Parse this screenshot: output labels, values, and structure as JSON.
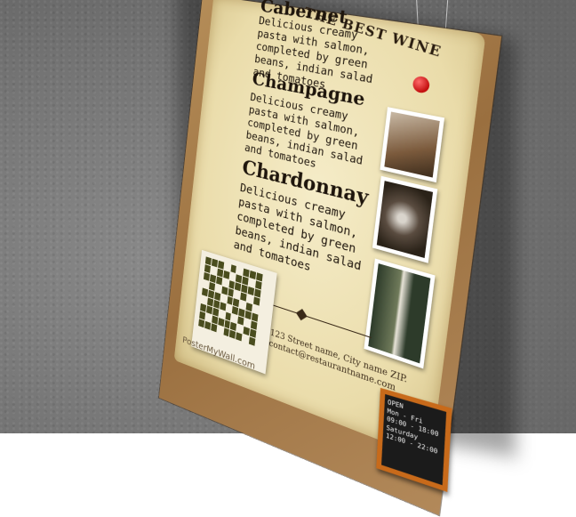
{
  "poster": {
    "title": "THE BEST WINE",
    "items": [
      {
        "name": "Cabernet",
        "description": "Delicious creamy pasta with salmon, completed by green beans, indian salad and tomatoes"
      },
      {
        "name": "Champagne",
        "description": "Delicious creamy pasta with salmon, completed by green beans, indian salad and tomatoes"
      },
      {
        "name": "Chardonnay",
        "description": "Delicious creamy pasta with salmon, completed by green beans, indian salad and tomatoes"
      }
    ],
    "address": {
      "line1": "123 Street name, City name ZIP.",
      "line2": "contact@restaurantname.com"
    },
    "brand": "PosterMyWall.com",
    "hours": {
      "title": "OPEN",
      "line1": "Mon - Fri",
      "line2": "09:00 - 18:00",
      "line3": "Saturday",
      "line4": "12:00 - 22:00"
    },
    "colors": {
      "wall": "#747474",
      "paper": "#eadcaa",
      "frame": "#9a6f3f",
      "pin": "#c20d0d",
      "chalkboard_frame": "#c86a1a"
    }
  }
}
